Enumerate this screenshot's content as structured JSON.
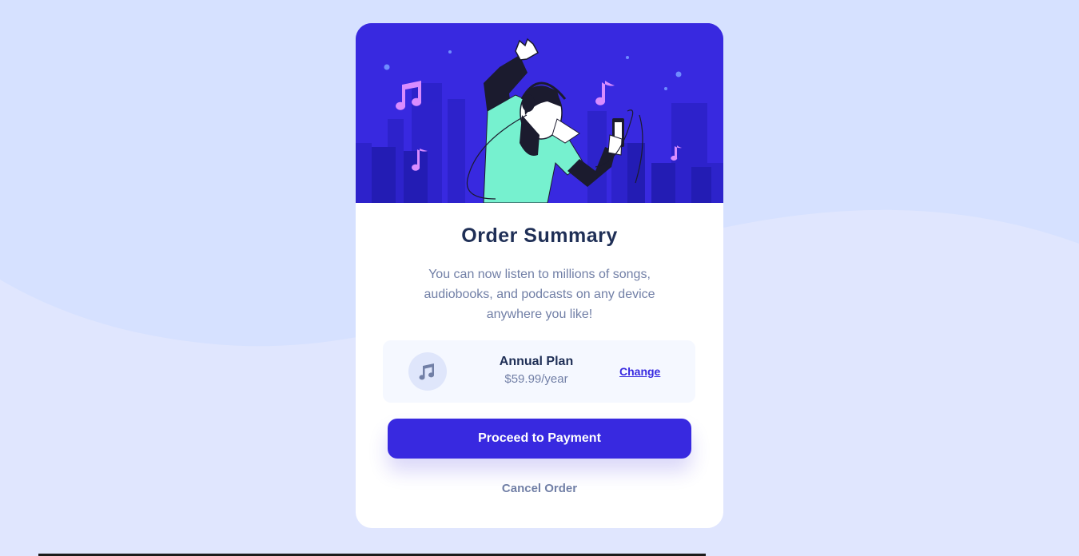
{
  "card": {
    "title": "Order Summary",
    "description": "You can now listen to millions of songs, audiobooks, and podcasts on any device anywhere you like!",
    "hero_image": "illustration-dancing-person-with-headphones"
  },
  "plan": {
    "icon": "music-note-icon",
    "name": "Annual Plan",
    "price": "$59.99/year",
    "change_label": "Change"
  },
  "actions": {
    "proceed_label": "Proceed to Payment",
    "cancel_label": "Cancel Order"
  },
  "colors": {
    "background": "#e0e6fe",
    "wave": "#d6e1ff",
    "accent": "#3829e0",
    "title": "#1f2f56",
    "muted": "#717fa6",
    "plan_bg": "#f5f8ff",
    "figure_shirt": "#76f1cf"
  }
}
